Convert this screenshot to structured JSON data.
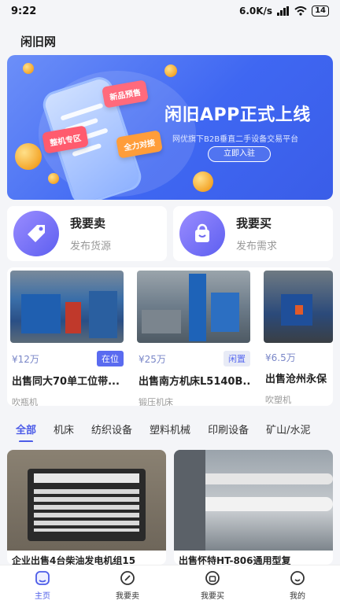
{
  "status": {
    "time": "9:22",
    "network": "6.0K/s",
    "battery": "14"
  },
  "app": {
    "title": "闲旧网"
  },
  "banner": {
    "title": "闲旧APP正式上线",
    "subtitle": "网优旗下B2B垂直二手设备交易平台",
    "button": "立即入驻",
    "tags": [
      "新品预售",
      "整机专区",
      "全力对接"
    ]
  },
  "actions": {
    "sell": {
      "title": "我要卖",
      "sub": "发布货源"
    },
    "buy": {
      "title": "我要买",
      "sub": "发布需求"
    }
  },
  "products": [
    {
      "price": "¥12万",
      "badge": "在位",
      "title": "出售同大70单工位带...",
      "category": "吹瓶机"
    },
    {
      "price": "¥25万",
      "badge": "闲置",
      "title": "出售南方机床L5140B...",
      "category": "锻压机床"
    },
    {
      "price": "¥6.5万",
      "badge": "",
      "title": "出售沧州永保",
      "category": "吹塑机"
    }
  ],
  "tabs": [
    "全部",
    "机床",
    "纺织设备",
    "塑料机械",
    "印刷设备",
    "矿山/水泥"
  ],
  "listings": [
    {
      "title": "企业出售4台柴油发电机组15"
    },
    {
      "title": "出售怀特HT-806通用型复"
    }
  ],
  "nav": [
    "主页",
    "我要卖",
    "我要买",
    "我的"
  ],
  "colors": {
    "accent": "#4c5ce8",
    "banner": "#3f67f2",
    "price": "#7a87c8"
  }
}
